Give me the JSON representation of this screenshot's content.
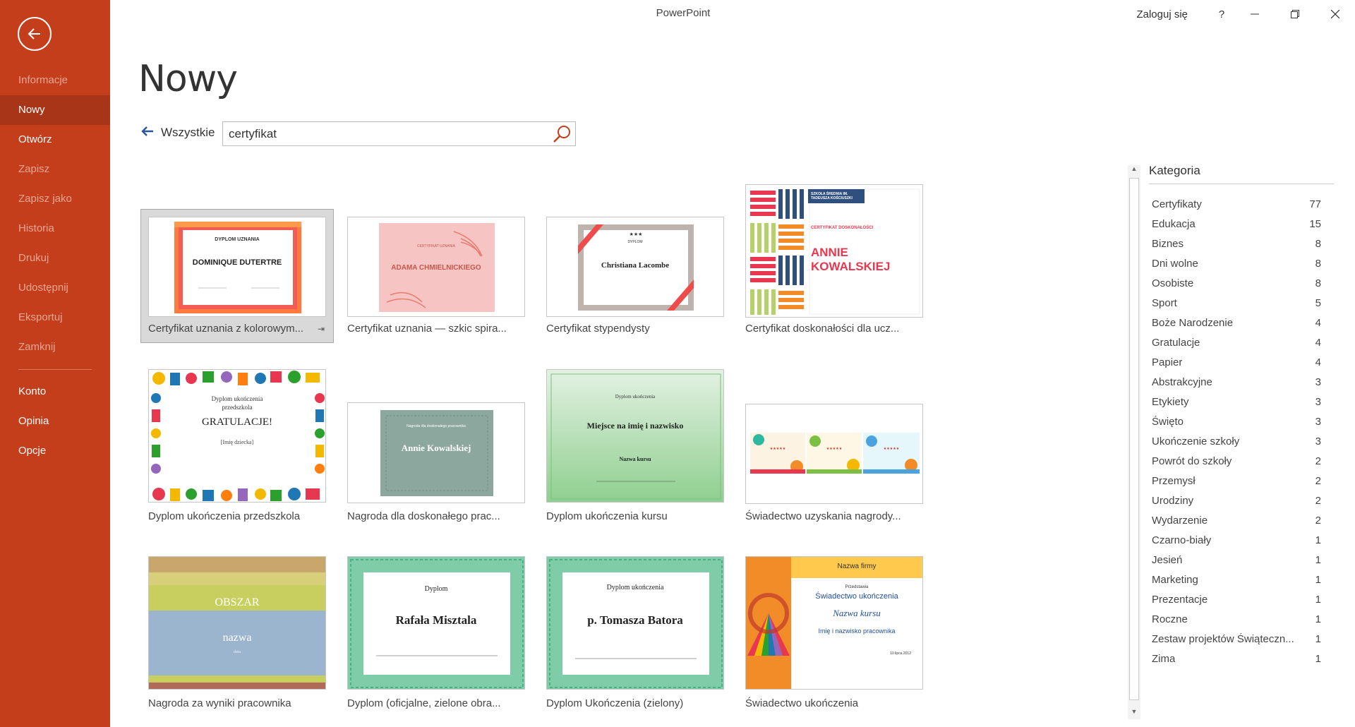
{
  "app": {
    "title": "PowerPoint"
  },
  "titlebar": {
    "signin": "Zaloguj się",
    "help": "?",
    "minimize": "—",
    "restore": "❐",
    "close": "✕"
  },
  "sidebar": {
    "items": [
      {
        "label": "Informacje"
      },
      {
        "label": "Nowy"
      },
      {
        "label": "Otwórz"
      },
      {
        "label": "Zapisz"
      },
      {
        "label": "Zapisz jako"
      },
      {
        "label": "Historia"
      },
      {
        "label": "Drukuj"
      },
      {
        "label": "Udostępnij"
      },
      {
        "label": "Eksportuj"
      },
      {
        "label": "Zamknij"
      }
    ],
    "bottom": [
      {
        "label": "Konto"
      },
      {
        "label": "Opinia"
      },
      {
        "label": "Opcje"
      }
    ]
  },
  "main": {
    "title": "Nowy",
    "all_link": "Wszystkie",
    "search_value": "certyfikat"
  },
  "templates": [
    {
      "label": "Certyfikat uznania z kolorowym...",
      "t1": "DYPLOM UZNANIA",
      "t2": "DOMINIQUE DUTERTRE"
    },
    {
      "label": "Certyfikat uznania — szkic spira...",
      "t1": "CERTYFIKAT UZNANIA",
      "t2": "ADAMA CHMIELNICKIEGO"
    },
    {
      "label": "Certyfikat stypendysty",
      "t1": "DYPLOM",
      "t2": "Christiana Lacombe"
    },
    {
      "label": "Certyfikat doskonałości dla ucz...",
      "t1": "SZKOŁA ŚREDNIA IM. TADEUSZA KOŚCIUSZKI",
      "t2": "CERTYFIKAT DOSKONAŁOŚCI",
      "t3": "ANNIE",
      "t4": "KOWALSKIEJ"
    },
    {
      "label": "Dyplom ukończenia przedszkola",
      "t1": "Dyplom ukończenia",
      "t2": "przedszkola",
      "t3": "GRATULACJE!",
      "t4": "[Imię dziecka]"
    },
    {
      "label": "Nagroda dla doskonałego prac...",
      "t1": "Nagroda dla doskonałego pracownika",
      "t2": "Annie Kowalskiej"
    },
    {
      "label": "Dyplom ukończenia kursu",
      "t1": "Dyplom ukończenia",
      "t2": "Miejsce na imię i nazwisko",
      "t3": "Nazwa kursu"
    },
    {
      "label": "Świadectwo uzyskania nagrody..."
    },
    {
      "label": "Nagroda za wyniki pracownika",
      "t1": "OBSZAR",
      "t2": "nazwa",
      "t3": "data"
    },
    {
      "label": "Dyplom (oficjalne, zielone obra...",
      "t1": "Dyplom",
      "t2": "Rafała Misztala"
    },
    {
      "label": "Dyplom Ukończenia (zielony)",
      "t1": "Dyplom ukończenia",
      "t2": "p. Tomasza Batora"
    },
    {
      "label": "Świadectwo ukończenia",
      "t1": "Nazwa firmy",
      "t2": "Przedstawia",
      "t3": "Świadectwo ukończenia",
      "t4": "Nazwa kursu",
      "t5": "Imię i nazwisko pracownika",
      "t6": "10 lipca 2012"
    }
  ],
  "categories": {
    "title": "Kategoria",
    "items": [
      {
        "name": "Certyfikaty",
        "count": "77"
      },
      {
        "name": "Edukacja",
        "count": "15"
      },
      {
        "name": "Biznes",
        "count": "8"
      },
      {
        "name": "Dni wolne",
        "count": "8"
      },
      {
        "name": "Osobiste",
        "count": "8"
      },
      {
        "name": "Sport",
        "count": "5"
      },
      {
        "name": "Boże Narodzenie",
        "count": "4"
      },
      {
        "name": "Gratulacje",
        "count": "4"
      },
      {
        "name": "Papier",
        "count": "4"
      },
      {
        "name": "Abstrakcyjne",
        "count": "3"
      },
      {
        "name": "Etykiety",
        "count": "3"
      },
      {
        "name": "Święto",
        "count": "3"
      },
      {
        "name": "Ukończenie szkoły",
        "count": "3"
      },
      {
        "name": "Powrót do szkoły",
        "count": "2"
      },
      {
        "name": "Przemysł",
        "count": "2"
      },
      {
        "name": "Urodziny",
        "count": "2"
      },
      {
        "name": "Wydarzenie",
        "count": "2"
      },
      {
        "name": "Czarno-biały",
        "count": "1"
      },
      {
        "name": "Jesień",
        "count": "1"
      },
      {
        "name": "Marketing",
        "count": "1"
      },
      {
        "name": "Prezentacje",
        "count": "1"
      },
      {
        "name": "Roczne",
        "count": "1"
      },
      {
        "name": "Zestaw projektów Świąteczn...",
        "count": "1"
      },
      {
        "name": "Zima",
        "count": "1"
      }
    ]
  },
  "colors": {
    "accent": "#c43e1c",
    "active": "#a83517",
    "link": "#2b579a"
  }
}
